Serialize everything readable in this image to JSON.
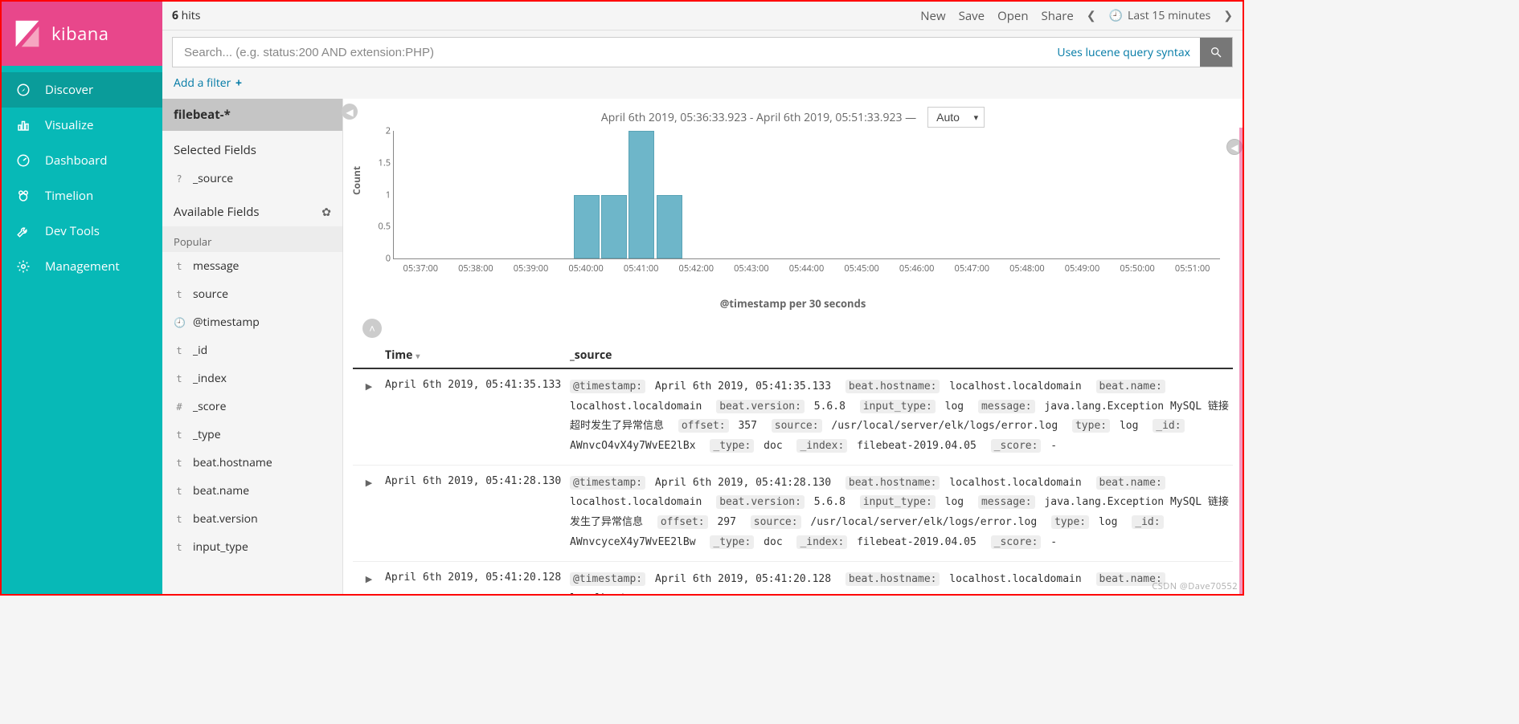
{
  "brand": {
    "name": "kibana"
  },
  "nav": {
    "items": [
      {
        "label": "Discover",
        "icon": "compass-icon",
        "active": true
      },
      {
        "label": "Visualize",
        "icon": "bar-chart-icon",
        "active": false
      },
      {
        "label": "Dashboard",
        "icon": "gauge-icon",
        "active": false
      },
      {
        "label": "Timelion",
        "icon": "bear-icon",
        "active": false
      },
      {
        "label": "Dev Tools",
        "icon": "wrench-icon",
        "active": false
      },
      {
        "label": "Management",
        "icon": "gear-icon",
        "active": false
      }
    ]
  },
  "topbar": {
    "hits_count": "6",
    "hits_label": "hits",
    "links": {
      "new": "New",
      "save": "Save",
      "open": "Open",
      "share": "Share"
    },
    "time_label": "Last 15 minutes"
  },
  "search": {
    "placeholder": "Search... (e.g. status:200 AND extension:PHP)",
    "lucene_hint": "Uses lucene query syntax",
    "add_filter": "Add a filter"
  },
  "fields_panel": {
    "index_pattern": "filebeat-*",
    "selected_title": "Selected Fields",
    "selected": [
      {
        "type": "?",
        "name": "_source"
      }
    ],
    "available_title": "Available Fields",
    "popular_title": "Popular",
    "popular": [
      {
        "type": "t",
        "name": "message"
      },
      {
        "type": "t",
        "name": "source"
      }
    ],
    "fields": [
      {
        "type": "🕘",
        "name": "@timestamp"
      },
      {
        "type": "t",
        "name": "_id"
      },
      {
        "type": "t",
        "name": "_index"
      },
      {
        "type": "#",
        "name": "_score"
      },
      {
        "type": "t",
        "name": "_type"
      },
      {
        "type": "t",
        "name": "beat.hostname"
      },
      {
        "type": "t",
        "name": "beat.name"
      },
      {
        "type": "t",
        "name": "beat.version"
      },
      {
        "type": "t",
        "name": "input_type"
      }
    ]
  },
  "chart_header": {
    "range_text": "April 6th 2019, 05:36:33.923 - April 6th 2019, 05:51:33.923 —",
    "interval": "Auto"
  },
  "chart_data": {
    "type": "bar",
    "title": "",
    "xlabel": "@timestamp per 30 seconds",
    "ylabel": "Count",
    "ylim": [
      0,
      2
    ],
    "y_ticks": [
      0,
      0.5,
      1,
      1.5,
      2
    ],
    "x_ticks": [
      "05:37:00",
      "05:38:00",
      "05:39:00",
      "05:40:00",
      "05:41:00",
      "05:42:00",
      "05:43:00",
      "05:44:00",
      "05:45:00",
      "05:46:00",
      "05:47:00",
      "05:48:00",
      "05:49:00",
      "05:50:00",
      "05:51:00"
    ],
    "x_range_minutes": [
      36.5,
      51.5
    ],
    "bars": [
      {
        "x_minute": 40.0,
        "value": 1
      },
      {
        "x_minute": 40.5,
        "value": 1
      },
      {
        "x_minute": 41.0,
        "value": 2
      },
      {
        "x_minute": 41.5,
        "value": 1
      }
    ]
  },
  "docs": {
    "header": {
      "time": "Time",
      "source": "_source"
    },
    "rows": [
      {
        "time": "April 6th 2019, 05:41:35.133",
        "kv": [
          [
            "@timestamp:",
            "April 6th 2019, 05:41:35.133"
          ],
          [
            "beat.hostname:",
            "localhost.localdomain"
          ],
          [
            "beat.name:",
            "localhost.localdomain"
          ],
          [
            "beat.version:",
            "5.6.8"
          ],
          [
            "input_type:",
            "log"
          ],
          [
            "message:",
            "java.lang.Exception MySQL 链接超时发生了异常信息"
          ],
          [
            "offset:",
            "357"
          ],
          [
            "source:",
            "/usr/local/server/elk/logs/error.log"
          ],
          [
            "type:",
            "log"
          ],
          [
            "_id:",
            "AWnvcO4vX4y7WvEE2lBx"
          ],
          [
            "_type:",
            "doc"
          ],
          [
            "_index:",
            "filebeat-2019.04.05"
          ],
          [
            "_score:",
            "-"
          ]
        ]
      },
      {
        "time": "April 6th 2019, 05:41:28.130",
        "kv": [
          [
            "@timestamp:",
            "April 6th 2019, 05:41:28.130"
          ],
          [
            "beat.hostname:",
            "localhost.localdomain"
          ],
          [
            "beat.name:",
            "localhost.localdomain"
          ],
          [
            "beat.version:",
            "5.6.8"
          ],
          [
            "input_type:",
            "log"
          ],
          [
            "message:",
            "java.lang.Exception MySQL 链接发生了异常信息"
          ],
          [
            "offset:",
            "297"
          ],
          [
            "source:",
            "/usr/local/server/elk/logs/error.log"
          ],
          [
            "type:",
            "log"
          ],
          [
            "_id:",
            "AWnvcyceX4y7WvEE2lBw"
          ],
          [
            "_type:",
            "doc"
          ],
          [
            "_index:",
            "filebeat-2019.04.05"
          ],
          [
            "_score:",
            "-"
          ]
        ]
      },
      {
        "time": "April 6th 2019, 05:41:20.128",
        "kv": [
          [
            "@timestamp:",
            "April 6th 2019, 05:41:20.128"
          ],
          [
            "beat.hostname:",
            "localhost.localdomain"
          ],
          [
            "beat.name:",
            "localhost."
          ]
        ]
      }
    ]
  },
  "watermark": "CSDN @Dave70552"
}
